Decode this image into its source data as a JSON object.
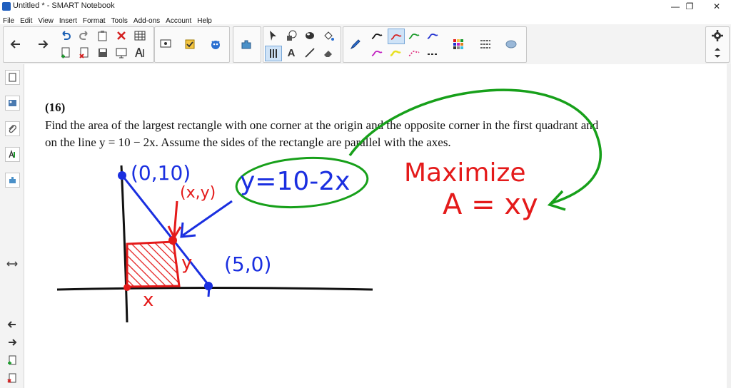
{
  "window": {
    "title": "Untitled * - SMART Notebook",
    "minimize": "—",
    "restore": "❐",
    "close": "✕"
  },
  "menu": [
    "File",
    "Edit",
    "View",
    "Insert",
    "Format",
    "Tools",
    "Add-ons",
    "Account",
    "Help"
  ],
  "toolbar": {
    "text_tool_glyph": "A",
    "pen_colors": [
      "#111111",
      "#d62020",
      "#1a9a2a",
      "#2030d0",
      "#e030b0",
      "#e03080"
    ]
  },
  "problem": {
    "number": "(16)",
    "line1": "Find the area of the largest rectangle with one corner at the origin and the opposite corner in the first quadrant and",
    "line2": "on the line y = 10 − 2x. Assume the sides of the rectangle are parallel with the axes."
  },
  "annotations": {
    "point_top": "(0,10)",
    "point_xy": "(x,y)",
    "equation": "y=10-2x",
    "point_right": "(5,0)",
    "label_x": "x",
    "label_y": "y",
    "maximize": "Maximize",
    "area_eq": "A = xy"
  },
  "colors": {
    "blue": "#1a2fe0",
    "red": "#e41a1a",
    "green": "#17a01a"
  }
}
